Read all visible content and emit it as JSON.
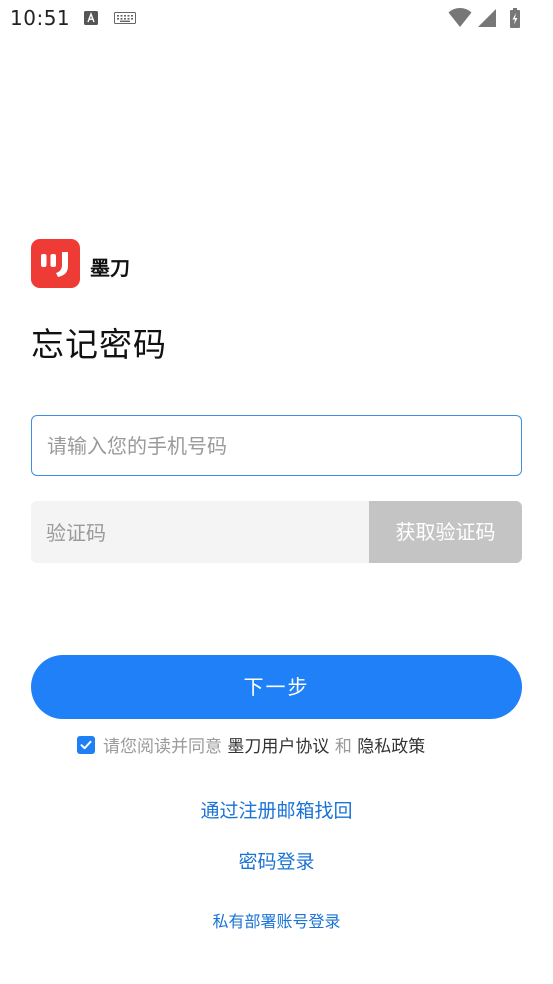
{
  "status_bar": {
    "time": "10:51"
  },
  "app": {
    "name": "墨刀",
    "brand_color": "#ee3b36",
    "accent_color": "#1f80f8"
  },
  "page": {
    "title": "忘记密码"
  },
  "form": {
    "phone_placeholder": "请输入您的手机号码",
    "phone_value": "",
    "code_placeholder": "验证码",
    "code_value": "",
    "get_code_label": "获取验证码",
    "next_label": "下一步"
  },
  "agreement": {
    "checked": true,
    "prefix": "请您阅读并同意",
    "user_agreement": "墨刀用户协议",
    "and": "和",
    "privacy_policy": "隐私政策"
  },
  "links": {
    "email_recovery": "通过注册邮箱找回",
    "password_login": "密码登录",
    "private_deploy_login": "私有部署账号登录"
  },
  "icons": {
    "status_left": [
      "text-a-icon",
      "keyboard-icon"
    ],
    "status_right": [
      "wifi-icon",
      "signal-icon",
      "battery-icon"
    ],
    "logo": "modao-logo-icon",
    "checkbox": "check-icon"
  }
}
